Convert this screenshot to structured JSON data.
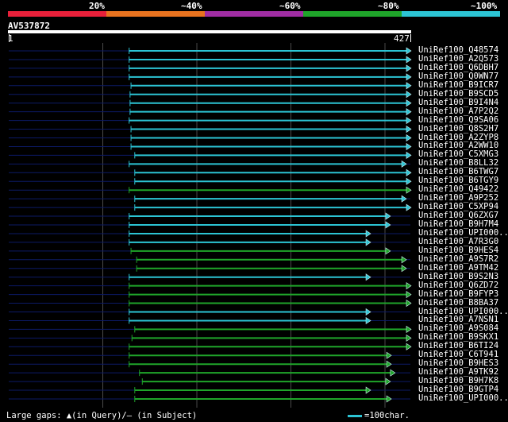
{
  "legend": {
    "labels": [
      "20%",
      "~40%",
      "~60%",
      "~80%",
      "~100%"
    ],
    "colors": [
      "#e8203a",
      "#e8731f",
      "#a02da3",
      "#1fa52a",
      "#2cc4d4"
    ]
  },
  "query": {
    "name": "AV537872",
    "start": "1",
    "end": "427",
    "length": 427
  },
  "colors": {
    "cyan": "#2cc4d4",
    "green": "#1fa52a",
    "grid": "#4a4a4a",
    "track": "#0c1a66"
  },
  "hits": [
    {
      "label": "UniRef100_Q48574",
      "start": 128,
      "end": 427,
      "color": "cyan"
    },
    {
      "label": "UniRef100_A2Q573",
      "start": 128,
      "end": 427,
      "color": "cyan"
    },
    {
      "label": "UniRef100_Q6DBH7",
      "start": 128,
      "end": 427,
      "color": "cyan"
    },
    {
      "label": "UniRef100_Q0WN77",
      "start": 128,
      "end": 427,
      "color": "cyan"
    },
    {
      "label": "UniRef100_B9ICR7",
      "start": 130,
      "end": 427,
      "color": "cyan"
    },
    {
      "label": "UniRef100_B9SCD5",
      "start": 129,
      "end": 427,
      "color": "cyan"
    },
    {
      "label": "UniRef100_B9I4N4",
      "start": 129,
      "end": 427,
      "color": "cyan"
    },
    {
      "label": "UniRef100_A7P2Q2",
      "start": 129,
      "end": 427,
      "color": "cyan"
    },
    {
      "label": "UniRef100_Q9SA06",
      "start": 128,
      "end": 427,
      "color": "cyan"
    },
    {
      "label": "UniRef100_Q8S2H7",
      "start": 130,
      "end": 427,
      "color": "cyan"
    },
    {
      "label": "UniRef100_A2ZYP8",
      "start": 130,
      "end": 427,
      "color": "cyan"
    },
    {
      "label": "UniRef100_A2WW10",
      "start": 130,
      "end": 427,
      "color": "cyan"
    },
    {
      "label": "UniRef100_C5XMG3",
      "start": 134,
      "end": 427,
      "color": "cyan"
    },
    {
      "label": "UniRef100_B8LL32",
      "start": 128,
      "end": 422,
      "color": "cyan"
    },
    {
      "label": "UniRef100_B6TWG7",
      "start": 134,
      "end": 427,
      "color": "cyan"
    },
    {
      "label": "UniRef100_B6TGY9",
      "start": 134,
      "end": 427,
      "color": "cyan"
    },
    {
      "label": "UniRef100_Q49422",
      "start": 128,
      "end": 427,
      "color": "green"
    },
    {
      "label": "UniRef100_A9P252",
      "start": 134,
      "end": 422,
      "color": "cyan"
    },
    {
      "label": "UniRef100_C5XP94",
      "start": 134,
      "end": 427,
      "color": "cyan"
    },
    {
      "label": "UniRef100_Q6ZXG7",
      "start": 128,
      "end": 405,
      "color": "cyan"
    },
    {
      "label": "UniRef100_B9H7M4",
      "start": 128,
      "end": 405,
      "color": "cyan"
    },
    {
      "label": "UniRef100_UPI000..",
      "start": 128,
      "end": 384,
      "color": "cyan"
    },
    {
      "label": "UniRef100_A7R3G0",
      "start": 128,
      "end": 384,
      "color": "cyan"
    },
    {
      "label": "UniRef100_B9HES4",
      "start": 130,
      "end": 405,
      "color": "green"
    },
    {
      "label": "UniRef100_A9S7R2",
      "start": 136,
      "end": 422,
      "color": "green"
    },
    {
      "label": "UniRef100_A9TM42",
      "start": 136,
      "end": 422,
      "color": "green"
    },
    {
      "label": "UniRef100_B9S2N3",
      "start": 128,
      "end": 384,
      "color": "cyan"
    },
    {
      "label": "UniRef100_Q6ZD72",
      "start": 128,
      "end": 427,
      "color": "green"
    },
    {
      "label": "UniRef100_B9FYP3",
      "start": 128,
      "end": 427,
      "color": "green"
    },
    {
      "label": "UniRef100_B8BA37",
      "start": 128,
      "end": 427,
      "color": "green"
    },
    {
      "label": "UniRef100_UPI000..",
      "start": 128,
      "end": 384,
      "color": "cyan"
    },
    {
      "label": "UniRef100_A7NSN1",
      "start": 128,
      "end": 384,
      "color": "cyan"
    },
    {
      "label": "UniRef100_A9S084",
      "start": 134,
      "end": 427,
      "color": "green"
    },
    {
      "label": "UniRef100_B9SKX1",
      "start": 131,
      "end": 427,
      "color": "green"
    },
    {
      "label": "UniRef100_B6TI24",
      "start": 128,
      "end": 427,
      "color": "green"
    },
    {
      "label": "UniRef100_C6T941",
      "start": 128,
      "end": 406,
      "color": "green"
    },
    {
      "label": "UniRef100_B9HES3",
      "start": 128,
      "end": 406,
      "color": "green"
    },
    {
      "label": "UniRef100_A9TK92",
      "start": 139,
      "end": 410,
      "color": "green"
    },
    {
      "label": "UniRef100_B9H7K8",
      "start": 142,
      "end": 405,
      "color": "green"
    },
    {
      "label": "UniRef100_B9GTP4",
      "start": 134,
      "end": 384,
      "color": "green"
    },
    {
      "label": "UniRef100_UPI000..",
      "start": 134,
      "end": 406,
      "color": "green"
    }
  ],
  "footer": {
    "gaps_text": "Large gaps: ▲(in Query)/– (in Subject)",
    "scale_text": "=100char."
  }
}
